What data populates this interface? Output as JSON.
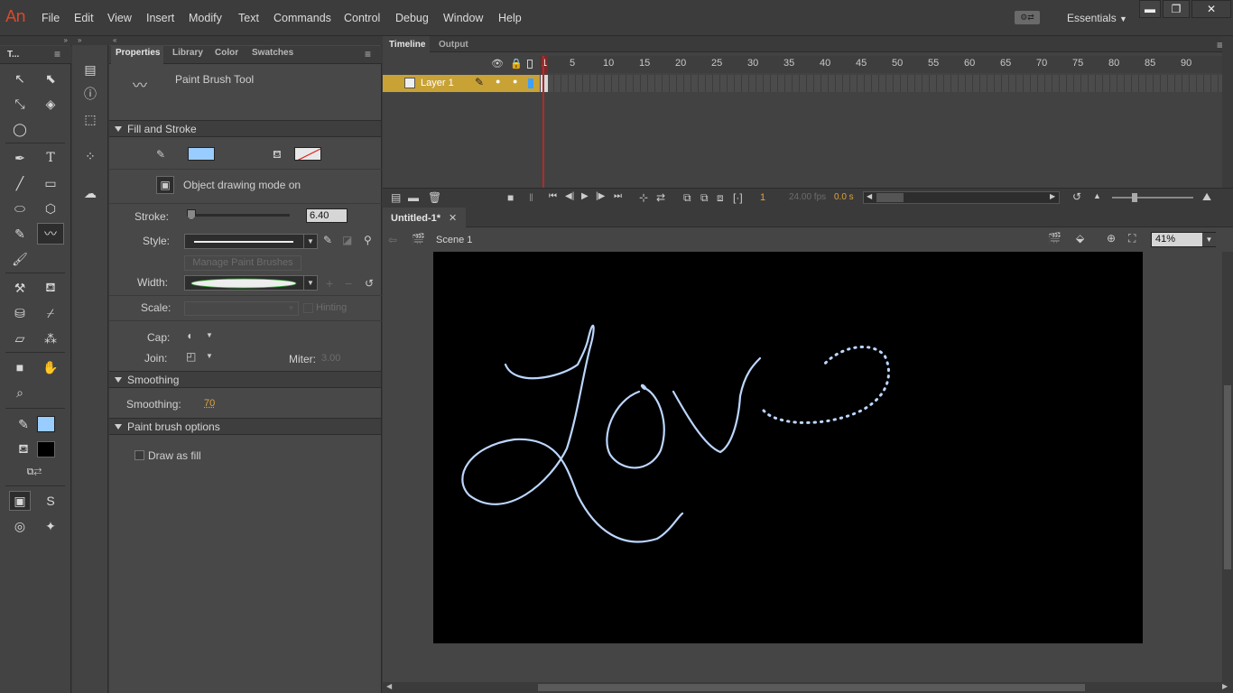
{
  "app": {
    "logo": "An",
    "workspace": "Essentials"
  },
  "menu": [
    "File",
    "Edit",
    "View",
    "Insert",
    "Modify",
    "Text",
    "Commands",
    "Control",
    "Debug",
    "Window",
    "Help"
  ],
  "tools_panel": {
    "title": "T..."
  },
  "properties": {
    "tabs": [
      "Properties",
      "Library",
      "Color",
      "Swatches"
    ],
    "tool_name": "Paint Brush Tool",
    "fill_stroke": "Fill and Stroke",
    "object_drawing": "Object drawing mode on",
    "stroke_label": "Stroke:",
    "stroke_value": "6.40",
    "style_label": "Style:",
    "manage_brushes": "Manage Paint Brushes",
    "width_label": "Width:",
    "scale_label": "Scale:",
    "hinting": "Hinting",
    "cap_label": "Cap:",
    "join_label": "Join:",
    "miter_label": "Miter:",
    "miter_value": "3.00",
    "smoothing_section": "Smoothing",
    "smoothing_label": "Smoothing:",
    "smoothing_value": "70",
    "brush_options": "Paint brush options",
    "draw_as_fill": "Draw as fill",
    "stroke_color": "#99ccff"
  },
  "timeline": {
    "tabs": [
      "Timeline",
      "Output"
    ],
    "layer": "Layer 1",
    "frames": [
      "1",
      "5",
      "10",
      "15",
      "20",
      "25",
      "30",
      "35",
      "40",
      "45",
      "50",
      "55",
      "60",
      "65",
      "70",
      "75",
      "80",
      "85",
      "90"
    ],
    "current_frame": "1",
    "fps": "24.00 fps",
    "time": "0.0 s"
  },
  "document": {
    "tab": "Untitled-1*",
    "scene": "Scene 1",
    "zoom": "41%"
  }
}
